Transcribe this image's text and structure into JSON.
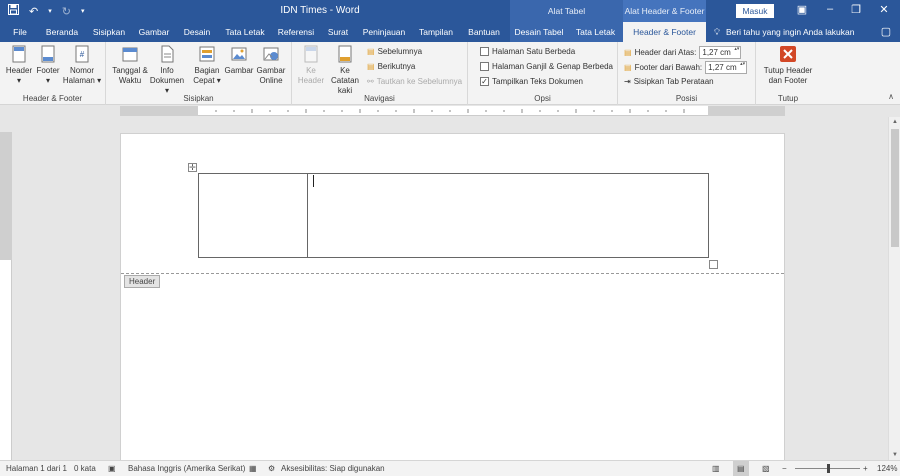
{
  "titlebar": {
    "title": "IDN Times  -  Word",
    "context_table": "Alat Tabel",
    "context_header": "Alat Header & Footer",
    "sign_in": "Masuk",
    "save_icon": "save-icon",
    "undo_icon": "undo-icon",
    "redo_icon": "redo-icon",
    "customize_icon": "customize-qat-icon"
  },
  "tabs": {
    "file": "File",
    "beranda": "Beranda",
    "sisipkan": "Sisipkan",
    "gambar": "Gambar",
    "desain": "Desain",
    "tata_letak": "Tata Letak",
    "referensi": "Referensi",
    "surat": "Surat",
    "peninjauan": "Peninjauan",
    "tampilan": "Tampilan",
    "bantuan": "Bantuan",
    "desain_tabel": "Desain Tabel",
    "tata_letak_tabel": "Tata Letak",
    "header_footer": "Header & Footer",
    "tell_me": "Beri tahu yang ingin Anda lakukan"
  },
  "ribbon": {
    "groups": {
      "header_footer": {
        "label": "Header & Footer",
        "header": "Header",
        "footer": "Footer",
        "page_number": "Nomor Halaman"
      },
      "sisipkan": {
        "label": "Sisipkan",
        "date_time": "Tanggal & Waktu",
        "doc_info": "Info Dokumen",
        "quick_parts": "Bagian Cepat",
        "pictures": "Gambar",
        "online_pictures": "Gambar Online"
      },
      "navigasi": {
        "label": "Navigasi",
        "go_header": "Ke Header",
        "go_footer": "Ke Catatan kaki",
        "previous": "Sebelumnya",
        "next": "Berikutnya",
        "link_previous": "Tautkan ke Sebelumnya"
      },
      "opsi": {
        "label": "Opsi",
        "different_first": "Halaman Satu Berbeda",
        "different_odd_even": "Halaman Ganjil & Genap Berbeda",
        "show_doc_text": "Tampilkan Teks Dokumen",
        "show_doc_text_checked": true
      },
      "posisi": {
        "label": "Posisi",
        "header_from_top_label": "Header dari Atas:",
        "header_from_top_value": "1,27 cm",
        "footer_from_bottom_label": "Footer dari Bawah:",
        "footer_from_bottom_value": "1,27 cm",
        "insert_alignment_tab": "Sisipkan Tab Perataan"
      },
      "tutup": {
        "label": "Tutup",
        "close": "Tutup Header dan Footer"
      }
    }
  },
  "document": {
    "header_tag": "Header"
  },
  "statusbar": {
    "page": "Halaman 1 dari 1",
    "words": "0 kata",
    "language": "Bahasa Inggris (Amerika Serikat)",
    "accessibility": "Aksesibilitas: Siap digunakan",
    "zoom": "124%"
  },
  "colors": {
    "accent": "#2b579a",
    "close_red": "#d24726"
  }
}
